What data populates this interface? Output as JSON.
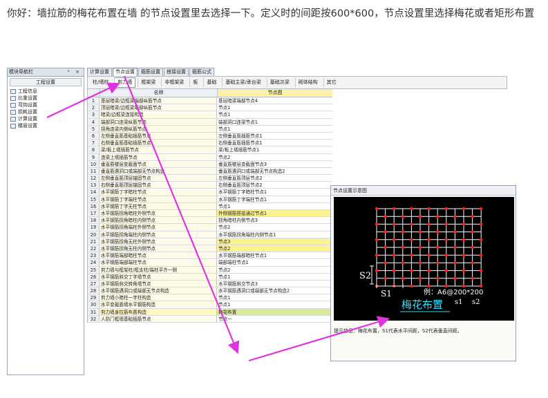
{
  "intro": {
    "text": "你好：墙拉筋的梅花布置在墙 的节点设置里去选择一下。定义时的间距按600*600，节点设置里选择梅花或者矩形布置"
  },
  "nav": {
    "title": "模块导航栏",
    "controls": "ᵖ ×",
    "header": "工程设置",
    "items": [
      {
        "label": "工程信息",
        "icon": "document-icon"
      },
      {
        "label": "比重设置",
        "icon": "table-icon"
      },
      {
        "label": "弯钩设置",
        "icon": "hook-icon"
      },
      {
        "label": "损耗设置",
        "icon": "chart-icon"
      },
      {
        "label": "计算设置",
        "icon": "calculator-icon"
      },
      {
        "label": "楼层设置",
        "icon": "floors-icon"
      }
    ]
  },
  "tabs": [
    "计算设置",
    "节点设置",
    "箍筋设置",
    "搭接设置",
    "箍筋公式"
  ],
  "active_tab": 1,
  "subtabs": [
    "柱/墙柱",
    "剪力墙",
    "框架梁",
    "非框架梁",
    "板",
    "基础",
    "基础主梁/承台梁",
    "基础次梁",
    "砌体结构",
    "其它"
  ],
  "active_subtab": 1,
  "grid": {
    "col_name": "名称",
    "col_node": "节点图",
    "rows": [
      {
        "n": "1",
        "name": "基层暗梁/边框梁端部纵筋节点",
        "node": "基层暗梁端部节点4",
        "hl": false
      },
      {
        "n": "2",
        "name": "顶层暗梁/边框梁端部纵筋节点",
        "node": "节点1",
        "hl": false
      },
      {
        "n": "3",
        "name": "暗梁/边框梁连接构造",
        "node": "节点1",
        "hl": false
      },
      {
        "n": "4",
        "name": "端部洞口连梁纵筋节点",
        "node": "端部洞口连梁节点1",
        "hl": false
      },
      {
        "n": "5",
        "name": "拐角连梁内侧纵筋节点",
        "node": "节点1",
        "hl": false
      },
      {
        "n": "6",
        "name": "左侧垂直筋基础插筋节点",
        "node": "左侧垂直筋插筋节点1",
        "hl": false
      },
      {
        "n": "7",
        "name": "右侧垂直筋基础插筋节点",
        "node": "右侧垂直筋插筋节点1",
        "hl": false
      },
      {
        "n": "8",
        "name": "梁/板上墙插筋节点",
        "node": "梁/板上墙插筋节点1",
        "hl": false
      },
      {
        "n": "9",
        "name": "连梁上墙插筋节点",
        "node": "节点2",
        "hl": false
      },
      {
        "n": "10",
        "name": "垂直筋楼层变截面节点",
        "node": "垂直筋楼层变截面节点3",
        "hl": false
      },
      {
        "n": "11",
        "name": "垂直筋遇洞口或端部无节点构造",
        "node": "垂直筋遇洞口或端部无节点构造2",
        "hl": false
      },
      {
        "n": "12",
        "name": "左侧垂直筋顶层锚固节点",
        "node": "左侧垂直筋顶层节点2",
        "hl": false
      },
      {
        "n": "13",
        "name": "右侧垂直筋顶层锚固节点",
        "node": "右侧垂直筋顶层节点2",
        "hl": false
      },
      {
        "n": "14",
        "name": "水平钢筋丁字暗柱节点",
        "node": "水平钢筋丁字暗柱节点1",
        "hl": false
      },
      {
        "n": "15",
        "name": "水平钢筋丁字端柱节点",
        "node": "水平钢筋丁字端柱节点1",
        "hl": false
      },
      {
        "n": "16",
        "name": "水平钢筋丁字无柱节点",
        "node": "节点1",
        "hl": false
      },
      {
        "n": "17",
        "name": "水平钢筋拐角暗柱外侧节点",
        "node": "外侧钢筋搭接通过节点1",
        "hl": true
      },
      {
        "n": "18",
        "name": "水平钢筋拐角暗柱内侧节点",
        "node": "拐角暗柱内侧节点3",
        "hl": false
      },
      {
        "n": "19",
        "name": "水平钢筋拐角端柱外侧节点",
        "node": "节点2",
        "hl": false
      },
      {
        "n": "20",
        "name": "水平钢筋拐角端柱内侧节点",
        "node": "水平钢筋拐角端柱内侧节点1",
        "hl": false
      },
      {
        "n": "21",
        "name": "水平钢筋拐角无柱外侧节点",
        "node": "节点3",
        "hl": true
      },
      {
        "n": "22",
        "name": "水平钢筋拐角无柱内侧节点",
        "node": "节点2",
        "hl": true
      },
      {
        "n": "23",
        "name": "水平钢筋端部暗柱节点",
        "node": "水平钢筋端部暗柱节点1",
        "hl": false
      },
      {
        "n": "24",
        "name": "水平钢筋端部端柱节点",
        "node": "端部端柱节点1",
        "hl": false
      },
      {
        "n": "25",
        "name": "剪力墙与框架柱/框支柱/端柱平齐一侧",
        "node": "节点2",
        "hl": false
      },
      {
        "n": "26",
        "name": "水平钢筋斜交丁字墙节点",
        "node": "节点1",
        "hl": false
      },
      {
        "n": "27",
        "name": "水平钢筋斜交转角墙节点",
        "node": "水平钢筋斜交节点3",
        "hl": false
      },
      {
        "n": "28",
        "name": "水平钢筋遇洞口或端部无节点构造",
        "node": "水平钢筋遇洞口或端部无节点构造2",
        "hl": false
      },
      {
        "n": "29",
        "name": "剪力墙小暗柱一字柱构造",
        "node": "节点1",
        "hl": false
      },
      {
        "n": "30",
        "name": "水平变截面墙水平钢筋构造",
        "node": "节点1",
        "hl": false
      },
      {
        "n": "31",
        "name": "剪力墙身拉筋布置构造",
        "node": "梅花布置",
        "hl": false,
        "sel": true
      },
      {
        "n": "32",
        "name": "人防门框墙基础插筋节点",
        "node": "节点一",
        "hl": false
      }
    ]
  },
  "preview": {
    "title": "节点设置示意图",
    "label_s2": "S2",
    "label_s1": "S1",
    "example": "例：A6@200*200",
    "pattern": "梅花布置",
    "sub_s1": "s1",
    "sub_s2": "s2",
    "desc_label": "提示信息：",
    "desc_text": "梅花布置，S1代表水平间距，S2代表垂直间距。"
  },
  "colors": {
    "annotation": "#e033e0",
    "rebar_dot": "#ff2020",
    "highlight": "#fbf38f",
    "selected": "#d9ea9a",
    "caption": "#2ee0ff"
  }
}
